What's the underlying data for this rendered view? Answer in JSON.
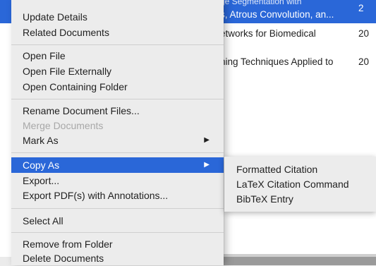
{
  "documents": {
    "rows": [
      {
        "title_line1": "ge Segmentation with",
        "title_line2": "s, Atrous Convolution, an...",
        "year": "2"
      },
      {
        "title": "etworks for Biomedical",
        "year": "20"
      },
      {
        "title": "ning Techniques Applied to",
        "year": "20"
      }
    ]
  },
  "context_menu": {
    "update_details": "Update Details",
    "related_documents": "Related Documents",
    "open_file": "Open File",
    "open_file_externally": "Open File Externally",
    "open_containing_folder": "Open Containing Folder",
    "rename_document_files": "Rename Document Files...",
    "merge_documents": "Merge Documents",
    "mark_as": "Mark As",
    "copy_as": "Copy As",
    "export": "Export...",
    "export_pdfs": "Export PDF(s) with Annotations...",
    "select_all": "Select All",
    "remove_from_folder": "Remove from Folder",
    "delete_documents": "Delete Documents",
    "submenu_arrow": "▶"
  },
  "submenu": {
    "formatted_citation": "Formatted Citation",
    "latex_citation_command": "LaTeX Citation Command",
    "bibtex_entry": "BibTeX Entry"
  },
  "colors": {
    "highlight": "#2a67d8",
    "menu_background": "#ececec",
    "disabled_text": "#a8a8a8"
  }
}
